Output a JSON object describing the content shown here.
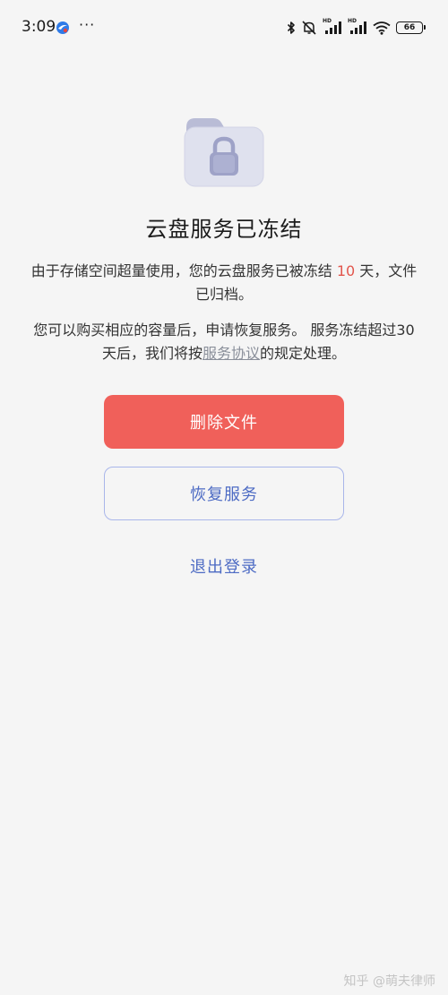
{
  "status_bar": {
    "time": "3:09",
    "app_icon": "browser-app-icon",
    "more": "···",
    "icons": [
      "bluetooth-icon",
      "mute-vibrate-icon",
      "hd-signal-icon",
      "hd-signal-icon",
      "wifi-icon",
      "battery-icon"
    ],
    "hd_label": "HD",
    "battery_level": "66"
  },
  "illustration": {
    "icon": "locked-folder-icon",
    "colors": {
      "folder_back": "#b9bcd6",
      "folder_front": "#dfe1ee",
      "lock": "#9ea2c7"
    }
  },
  "main": {
    "title": "云盘服务已冻结",
    "description_1": {
      "before_days": "由于存储空间超量使用，您的云盘服务已被冻结",
      "days": "10",
      "after_days": "天，文件已归档。"
    },
    "description_2": {
      "before_link": "您可以购买相应的容量后，申请恢复服务。 服务冻结超过30天后，我们将按",
      "link": "服务协议",
      "after_link": "的规定处理。"
    }
  },
  "actions": {
    "delete_label": "删除文件",
    "restore_label": "恢复服务",
    "logout_label": "退出登录"
  },
  "colors": {
    "background": "#f5f5f5",
    "danger": "#f0605a",
    "accent": "#4d6bc4",
    "outline": "#a9b6ea",
    "highlight_number": "#e2564d"
  },
  "watermark": "知乎 @萌夫律师"
}
